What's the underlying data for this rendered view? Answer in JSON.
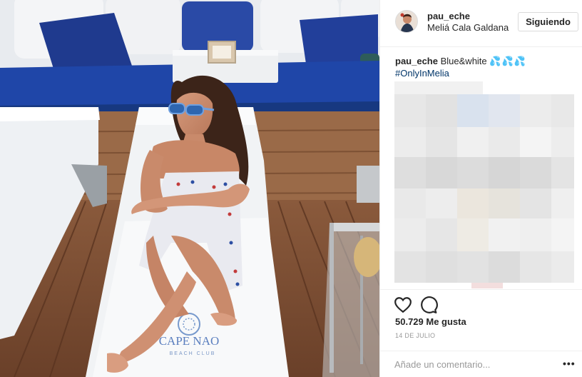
{
  "post": {
    "username": "pau_eche",
    "location": "Meliá Cala Galdana",
    "follow_label": "Siguiendo",
    "caption_user": "pau_eche",
    "caption_text": "Blue&white",
    "caption_emoji": "💦💦💦",
    "hashtag": "#OnlyInMelia",
    "likes": "50.729 Me gusta",
    "date": "14 DE JULIO",
    "comment_placeholder": "Añade un comentario...",
    "more_label": "•••"
  },
  "photo": {
    "towel_logo": "CAPE NAO",
    "towel_sublogo": "BEACH CLUB"
  },
  "colors": {
    "cushion_blue": "#1f3f95",
    "deck_wood": "#7a4e34",
    "hashtag": "#003569",
    "text": "#262626",
    "muted": "#999999",
    "border": "#dbdbdb"
  },
  "icons": [
    "heart-icon",
    "comment-icon",
    "more-options-icon"
  ]
}
